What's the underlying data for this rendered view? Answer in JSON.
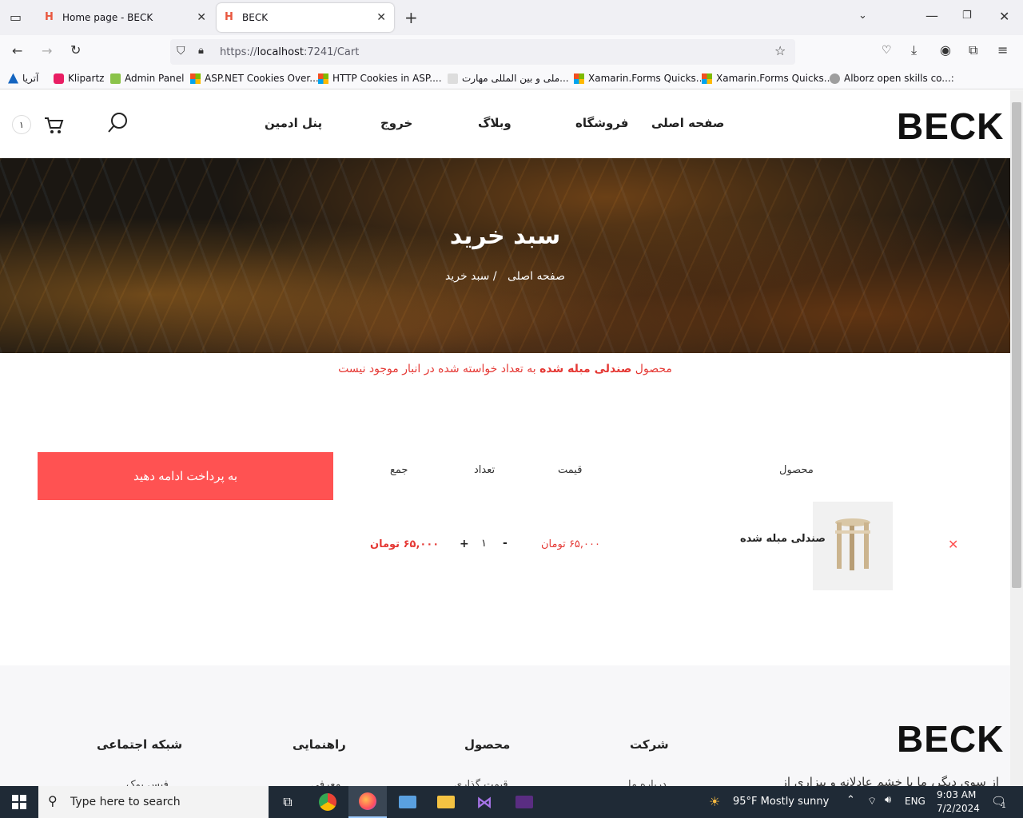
{
  "browser": {
    "tabs": [
      {
        "title": "Home page - BECK",
        "active": false
      },
      {
        "title": "BECK",
        "active": true
      }
    ],
    "url_prefix": "https://",
    "url_host": "localhost",
    "url_rest": ":7241/Cart",
    "bookmarks": [
      "آتریا",
      "Klipartz",
      "Admin Panel",
      "ASP.NET Cookies Over...",
      "HTTP Cookies in ASP....",
      "ملی و بین المللی مهارت...",
      "Xamarin.Forms Quicks...",
      "Xamarin.Forms Quicks...",
      "Alborz open skills co...:"
    ]
  },
  "site": {
    "logo": "BECK",
    "menu": [
      "صفحه اصلی",
      "فروشگاه",
      "وبلاگ",
      "خروج",
      "پنل ادمین"
    ],
    "cart_count": "۱",
    "hero_title": "سبد خرید",
    "crumb_home": "صفحه اصلی",
    "crumb_sep": "/",
    "crumb_current": "سبد خرید",
    "alert_prefix": "محصول ",
    "alert_product": "صندلی مبله شده",
    "alert_suffix": " به تعداد خواسته شده در انبار موجود نیست",
    "table_headers": {
      "product": "محصول",
      "price": "قیمت",
      "qty": "تعداد",
      "total": "جمع"
    },
    "checkout_label": "به پرداخت ادامه دهید",
    "cart_item": {
      "name": "صندلی مبله شده",
      "price": "۶۵,۰۰۰ تومان",
      "qty": "۱",
      "plus": "+",
      "minus": "-",
      "total": "۶۵,۰۰۰ تومان"
    }
  },
  "footer": {
    "logo": "BECK",
    "tagline": "از سوی دیگر، ما با خشم عادلانه و بیزاری از",
    "columns": [
      {
        "title": "شرکت",
        "link": "درباره ما"
      },
      {
        "title": "محصول",
        "link": "قیمت گذاری"
      },
      {
        "title": "راهنمایی",
        "link": "معرفی"
      },
      {
        "title": "شبکه اجتماعی",
        "link": "فیس بوک"
      }
    ]
  },
  "taskbar": {
    "search_placeholder": "Type here to search",
    "weather": "95°F  Mostly sunny",
    "lang": "ENG",
    "time": "9:03 AM",
    "date": "7/2/2024",
    "notif_count": "1"
  },
  "colors": {
    "accent": "#ff5252",
    "price": "#e53935"
  }
}
